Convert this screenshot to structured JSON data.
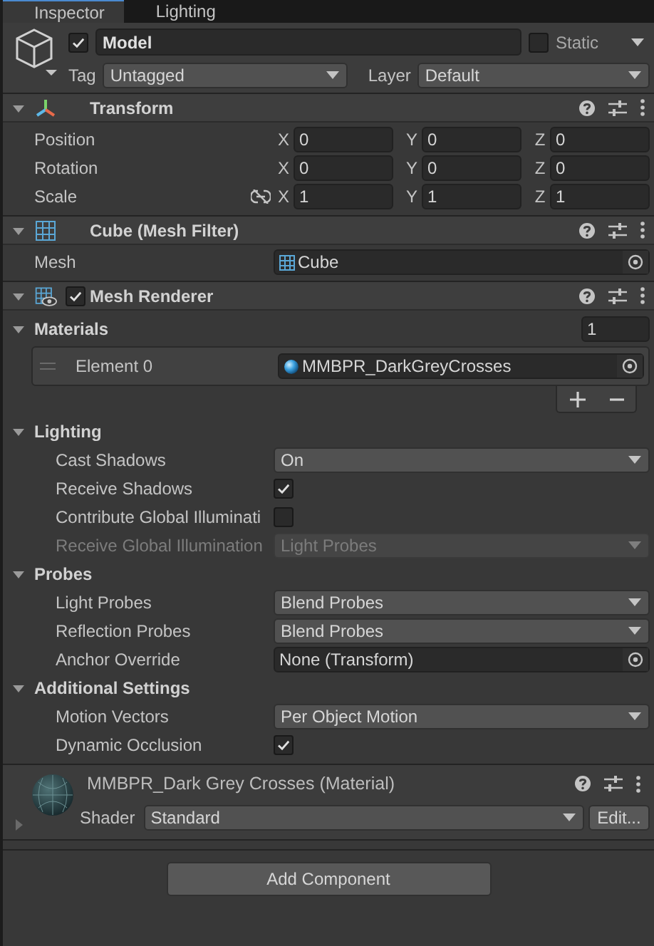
{
  "tabs": [
    {
      "label": "Inspector",
      "selected": true
    },
    {
      "label": "Lighting",
      "selected": false
    }
  ],
  "object": {
    "active": true,
    "name": "Model",
    "static": false,
    "static_label": "Static",
    "tag_label": "Tag",
    "tag": "Untagged",
    "layer_label": "Layer",
    "layer": "Default"
  },
  "components": [
    {
      "kind": "transform",
      "title": "Transform",
      "expanded": true,
      "rows": [
        {
          "kind": "vector3",
          "label": "Position",
          "values": [
            {
              "axis": "X",
              "value": "0"
            },
            {
              "axis": "Y",
              "value": "0"
            },
            {
              "axis": "Z",
              "value": "0"
            }
          ]
        },
        {
          "kind": "vector3",
          "label": "Rotation",
          "values": [
            {
              "axis": "X",
              "value": "0"
            },
            {
              "axis": "Y",
              "value": "0"
            },
            {
              "axis": "Z",
              "value": "0"
            }
          ]
        },
        {
          "kind": "vector3",
          "label": "Scale",
          "proportional_toggle": true,
          "values": [
            {
              "axis": "X",
              "value": "1"
            },
            {
              "axis": "Y",
              "value": "1"
            },
            {
              "axis": "Z",
              "value": "1"
            }
          ]
        }
      ]
    },
    {
      "kind": "mesh_filter",
      "title": "Cube (Mesh Filter)",
      "expanded": true,
      "rows": [
        {
          "kind": "mesh_field",
          "label": "Mesh",
          "value": "Cube"
        }
      ]
    },
    {
      "kind": "mesh_renderer",
      "title": "Mesh Renderer",
      "expanded": true,
      "enabled": true,
      "rows": [
        {
          "kind": "array",
          "label": "Materials",
          "expanded": true,
          "size": "1",
          "elements": [
            {
              "kind": "material_field",
              "label": "Element 0",
              "value": "MMBPR_DarkGreyCrosses"
            }
          ]
        },
        {
          "kind": "section",
          "label": "Lighting",
          "expanded": true,
          "children": [
            {
              "kind": "dropdown",
              "label": "Cast Shadows",
              "value": "On",
              "disabled": false
            },
            {
              "kind": "checkbox",
              "label": "Receive Shadows",
              "checked": true,
              "disabled": false
            },
            {
              "kind": "checkbox",
              "label": "Contribute Global Illuminati",
              "checked": false,
              "disabled": false
            },
            {
              "kind": "dropdown",
              "label": "Receive Global Illumination",
              "value": "Light Probes",
              "disabled": true
            }
          ]
        },
        {
          "kind": "section",
          "label": "Probes",
          "expanded": true,
          "children": [
            {
              "kind": "dropdown",
              "label": "Light Probes",
              "value": "Blend Probes",
              "disabled": false
            },
            {
              "kind": "dropdown",
              "label": "Reflection Probes",
              "value": "Blend Probes",
              "disabled": false
            },
            {
              "kind": "object",
              "label": "Anchor Override",
              "value": "None (Transform)",
              "disabled": false
            }
          ]
        },
        {
          "kind": "section",
          "label": "Additional Settings",
          "expanded": true,
          "children": [
            {
              "kind": "dropdown",
              "label": "Motion Vectors",
              "value": "Per Object Motion",
              "disabled": false
            },
            {
              "kind": "checkbox",
              "label": "Dynamic Occlusion",
              "checked": true,
              "disabled": false
            }
          ]
        }
      ]
    },
    {
      "kind": "material",
      "title": "MMBPR_Dark Grey Crosses (Material)",
      "expanded": false,
      "shader_label": "Shader",
      "shader": "Standard",
      "edit": "Edit..."
    }
  ],
  "add_component": "Add Component"
}
